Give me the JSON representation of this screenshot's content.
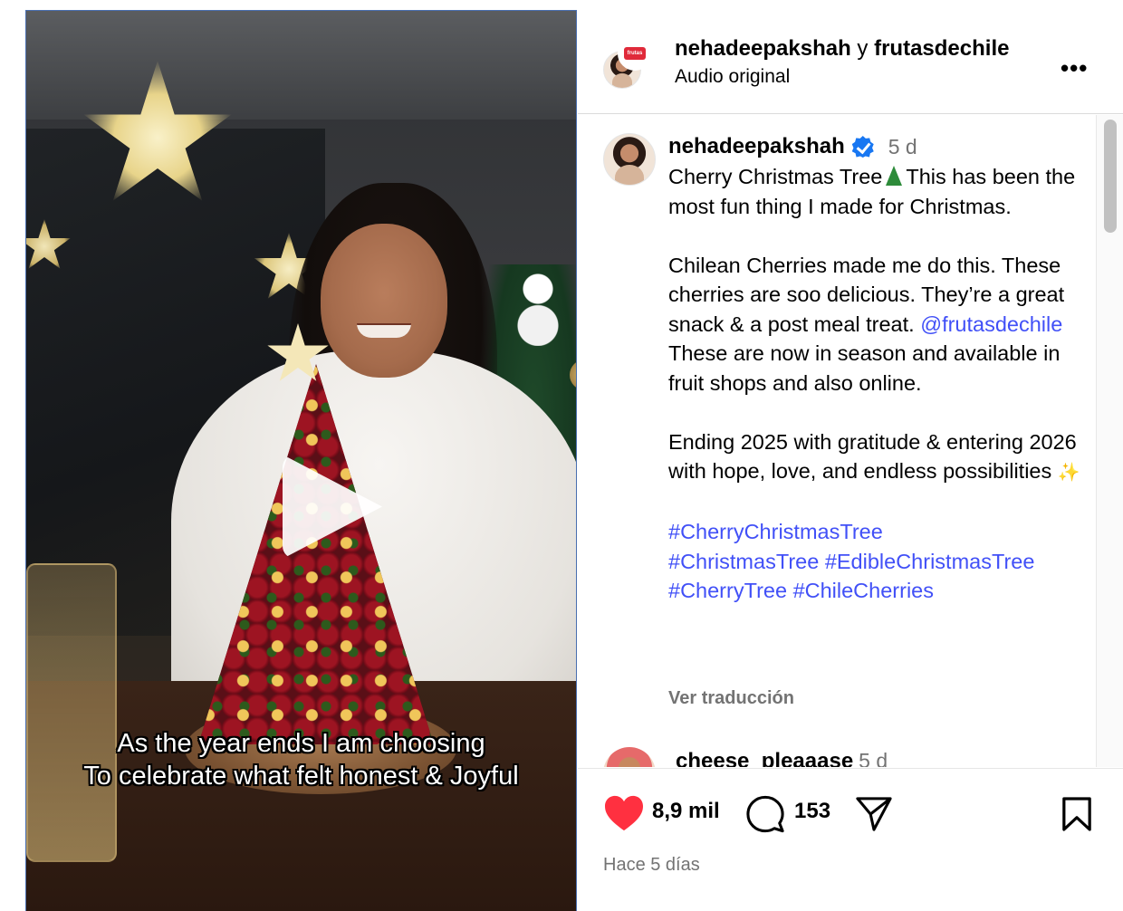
{
  "video": {
    "caption_line1": "As the year ends I am choosing",
    "caption_line2": "To celebrate what felt honest & Joyful"
  },
  "header": {
    "user1": "nehadeepakshah",
    "conjunction": "y",
    "user2": "frutasdechile",
    "audio": "Audio original"
  },
  "post": {
    "username": "nehadeepakshah",
    "time": "5 d",
    "caption": {
      "p1a": "Cherry Christmas Tree",
      "p1b": "This has been the most fun thing I made for Christmas.",
      "p2a": "Chilean Cherries made me do this. These cherries are soo delicious. They’re a great snack & a post meal treat.",
      "mention": "@frutasdechile",
      "p2b": "These are now in season and available in fruit shops and also online.",
      "p3": "Ending 2025 with gratitude & entering 2026 with hope, love, and endless possibilities",
      "hashtags": [
        "#CherryChristmasTree",
        "#ChristmasTree",
        "#EdibleChristmasTree",
        "#CherryTree",
        "#ChileCherries"
      ]
    },
    "translate_label": "Ver traducción"
  },
  "next_comment": {
    "username": "cheese_pleaaase",
    "time": "5 d"
  },
  "actions": {
    "likes": "8,9 mil",
    "comments": "153",
    "timestamp": "Hace 5 días",
    "like_color": "#ff3040"
  },
  "icons": [
    "play-icon",
    "more-options-icon",
    "verified-badge-icon",
    "heart-icon",
    "comment-icon",
    "share-icon",
    "bookmark-icon"
  ]
}
